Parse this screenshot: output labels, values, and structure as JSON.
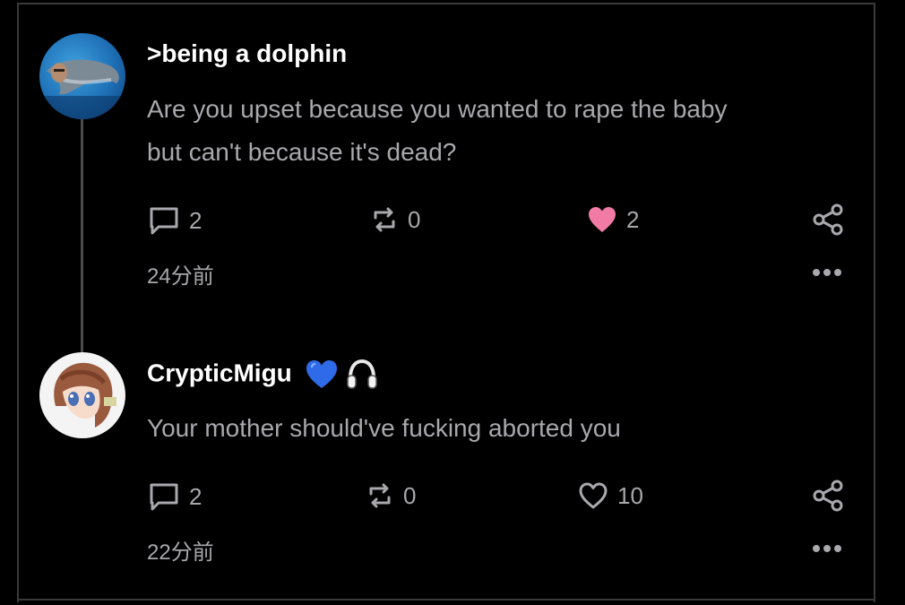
{
  "colors": {
    "background": "#000000",
    "text_secondary": "#a8a8ad",
    "like_active": "#f27ba6",
    "border": "#3a3a3c"
  },
  "posts": [
    {
      "username": ">being a dolphin",
      "avatar": "dolphin-avatar",
      "text_line1": "Are you upset because you wanted to rape the baby",
      "text_line2": "but can't because it's dead?",
      "replies": "2",
      "reposts": "0",
      "likes": "2",
      "liked": true,
      "timestamp": "24分前"
    },
    {
      "username": "CrypticMigu",
      "badges": [
        "blue-heart-emoji",
        "headphones-emoji"
      ],
      "avatar": "anime-girl-avatar",
      "text": "Your mother should've fucking aborted you",
      "replies": "2",
      "reposts": "0",
      "likes": "10",
      "liked": false,
      "timestamp": "22分前"
    }
  ]
}
